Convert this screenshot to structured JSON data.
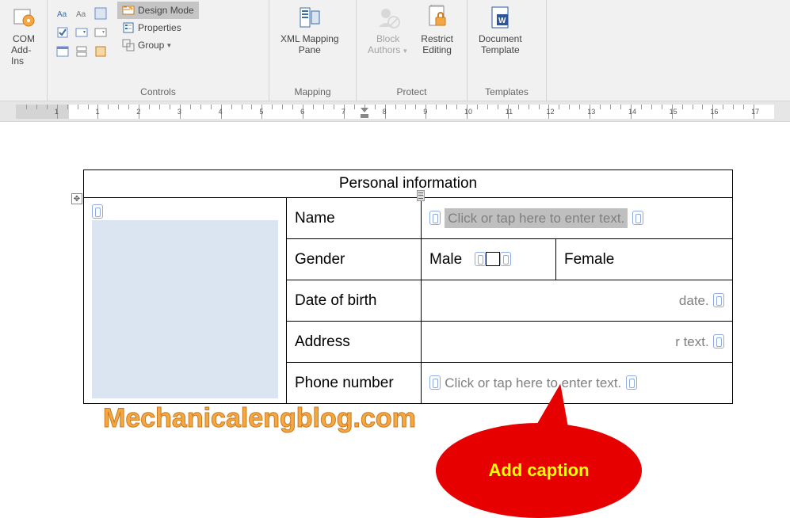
{
  "ribbon": {
    "addins_group": {
      "label": "COM",
      "label2": "Add-Ins"
    },
    "controls_group": {
      "label": "Controls",
      "design_mode": "Design Mode",
      "properties": "Properties",
      "group_btn": "Group"
    },
    "mapping_group": {
      "label": "Mapping",
      "xml_pane": "XML Mapping",
      "xml_pane2": "Pane"
    },
    "protect_group": {
      "label": "Protect",
      "block_authors": "Block",
      "block_authors2": "Authors",
      "restrict": "Restrict",
      "restrict2": "Editing"
    },
    "templates_group": {
      "label": "Templates",
      "doc_template": "Document",
      "doc_template2": "Template"
    }
  },
  "form": {
    "title": "Personal information",
    "rows": {
      "name": {
        "label": "Name",
        "placeholder": "Click or tap here to enter text."
      },
      "gender": {
        "label": "Gender",
        "male": "Male",
        "female": "Female"
      },
      "dob": {
        "label": "Date of birth",
        "placeholder_tail": "date."
      },
      "address": {
        "label": "Address",
        "placeholder_tail": "r text."
      },
      "phone": {
        "label": "Phone number",
        "placeholder": "Click or tap here to enter text."
      }
    }
  },
  "callout": {
    "text": "Add caption"
  },
  "watermark": "Mechanicalengblog.com",
  "ruler": {
    "numbers": [
      1,
      1,
      2,
      3,
      4,
      5,
      6,
      7,
      8,
      9,
      10,
      11,
      12,
      13,
      14,
      15,
      16,
      17
    ]
  }
}
